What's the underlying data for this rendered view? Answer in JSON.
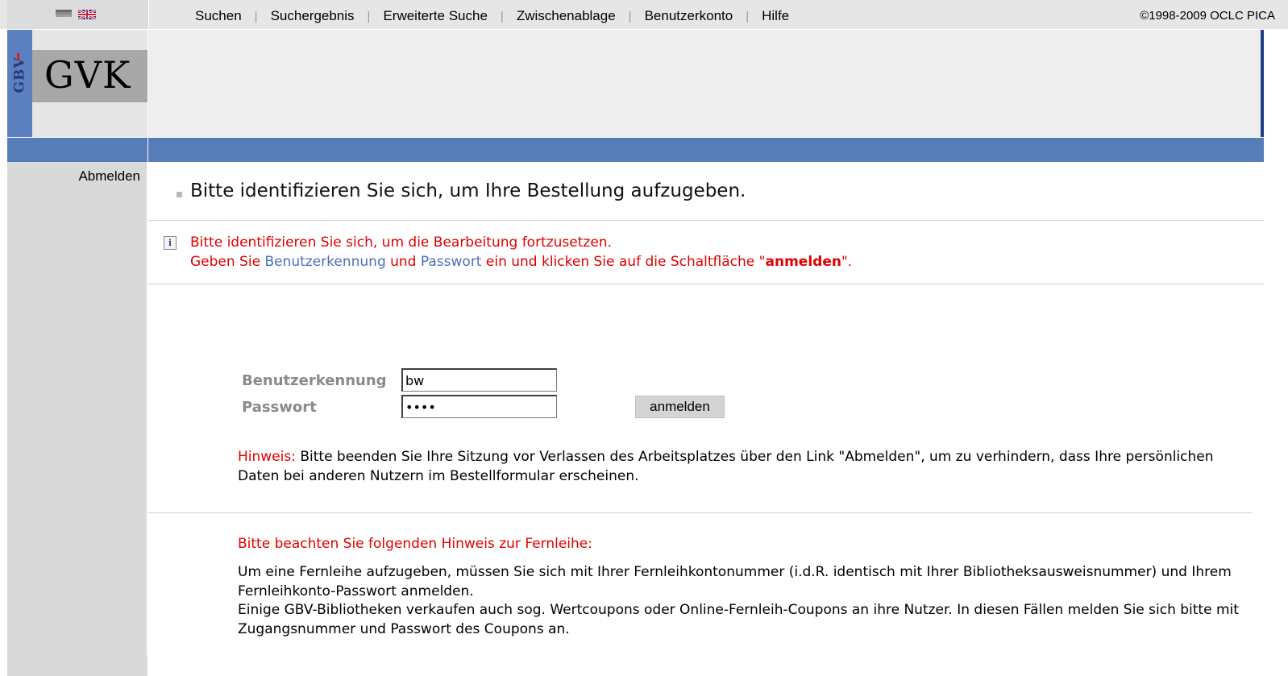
{
  "nav": {
    "items": [
      "Suchen",
      "Suchergebnis",
      "Erweiterte Suche",
      "Zwischenablage",
      "Benutzerkonto",
      "Hilfe"
    ],
    "copyright": "©1998-2009 OCLC PICA"
  },
  "logo": {
    "gbv": "GBV",
    "gvk": "GVK"
  },
  "sidebar": {
    "logout": "Abmelden"
  },
  "heading": "Bitte identifizieren Sie sich, um Ihre Bestellung aufzugeben.",
  "info": {
    "line1": "Bitte identifizieren Sie sich, um die Bearbeitung fortzusetzen.",
    "line2_a": "Geben Sie ",
    "line2_user": "Benutzerkennung",
    "line2_b": " und ",
    "line2_pass": "Passwort",
    "line2_c": " ein und klicken Sie auf die Schaltfläche \"",
    "line2_btn": "anmelden",
    "line2_d": "\"."
  },
  "form": {
    "user_label": "Benutzerkennung",
    "user_value": "bw",
    "pass_label": "Passwort",
    "pass_value": "xxxx",
    "submit_label": "anmelden"
  },
  "hint": {
    "label": "Hinweis:",
    "text": " Bitte beenden Sie Ihre Sitzung vor Verlassen des Arbeitsplatzes über den Link \"Abmelden\", um zu verhindern, dass Ihre persönlichen Daten bei anderen Nutzern im Bestellformular erscheinen."
  },
  "fernleihe": {
    "title": "Bitte beachten Sie folgenden Hinweis zur Fernleihe:",
    "p1": "Um eine Fernleihe aufzugeben, müssen Sie sich mit Ihrer Fernleihkontonummer (i.d.R. identisch mit Ihrer Bibliotheksausweisnummer) und Ihrem Fernleihkonto-Passwort anmelden.",
    "p2": "Einige GBV-Bibliotheken verkaufen auch sog. Wertcoupons oder Online-Fernleih-Coupons an ihre Nutzer. In diesen Fällen melden Sie sich bitte mit Zugangsnummer und Passwort des Coupons an."
  },
  "colors": {
    "band": "#577db9",
    "alert": "#e00000",
    "link": "#4f6fb8"
  }
}
